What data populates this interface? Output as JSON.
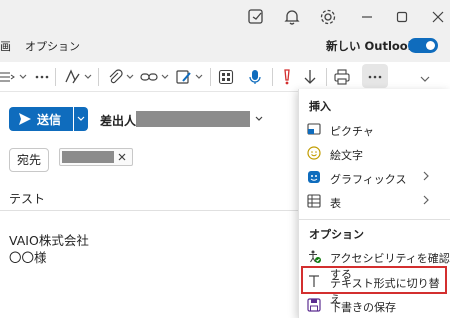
{
  "tabs": {
    "partial": "画",
    "options": "オプション"
  },
  "new_outlook": {
    "label": "新しい Outlook",
    "enabled": true
  },
  "compose": {
    "send_label": "送信",
    "from_label": "差出人:",
    "to_label": "宛先",
    "subject": "テスト",
    "body_line1": "VAIO株式会社",
    "body_line2": "〇〇様"
  },
  "menu": {
    "insert_heading": "挿入",
    "items_insert": [
      {
        "label": "ピクチャ",
        "icon": "picture-icon"
      },
      {
        "label": "絵文字",
        "icon": "emoji-icon"
      },
      {
        "label": "グラフィックス",
        "icon": "graphics-icon"
      },
      {
        "label": "表",
        "icon": "table-icon"
      }
    ],
    "options_heading": "オプション",
    "items_options": [
      {
        "label": "アクセシビリティを確認する",
        "icon": "accessibility-icon"
      },
      {
        "label": "テキスト形式に切り替え",
        "icon": "text-format-icon"
      },
      {
        "label": "下書きの保存",
        "icon": "save-icon"
      }
    ]
  },
  "colors": {
    "accent": "#0f6cbd",
    "highlight": "#d32f2f"
  }
}
